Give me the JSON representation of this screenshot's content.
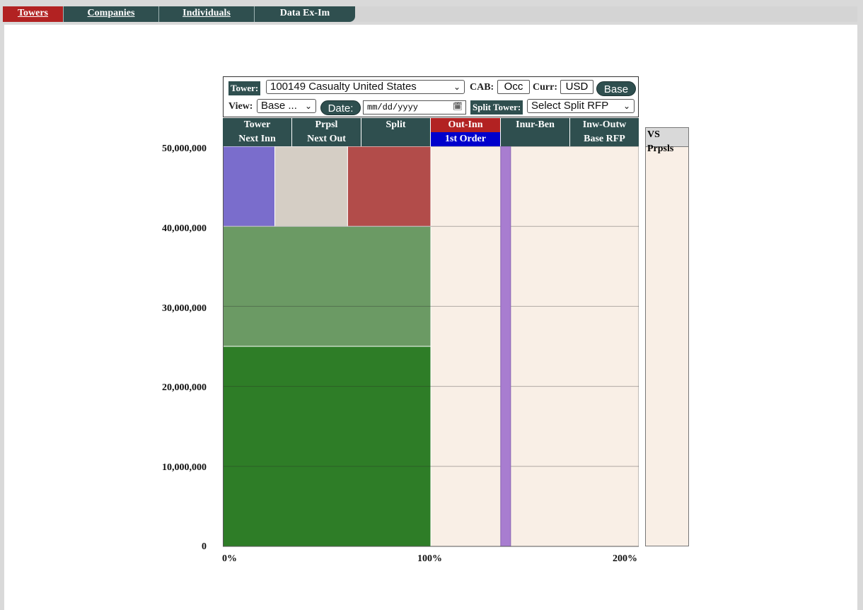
{
  "nav": {
    "tabs": [
      "Towers",
      "Companies",
      "Individuals",
      "Data Ex-Im"
    ]
  },
  "controls": {
    "tower_label": "Tower:",
    "tower_value": "100149 Casualty United States",
    "cab_label": "CAB:",
    "cab_value": "Occ",
    "curr_label": "Curr:",
    "curr_value": "USD",
    "base_button": "Base",
    "view_label": "View:",
    "view_value": "Base ...",
    "date_button": "Date:",
    "date_placeholder": "mm/dd/yyyy",
    "split_label": "Split Tower:",
    "split_value": "Select Split RFP"
  },
  "header_row1": [
    "Tower",
    "Prpsl",
    "Split",
    "Out-Inn",
    "Inur-Ben",
    "Inw-Outw"
  ],
  "header_row2": [
    "Next Inn",
    "Next Out",
    "",
    "1st Order",
    "",
    "Base RFP"
  ],
  "vs_label": "VS Prpsls",
  "chart_data": {
    "type": "bar",
    "y_ticks": [
      "50,000,000",
      "40,000,000",
      "30,000,000",
      "20,000,000",
      "10,000,000",
      "0"
    ],
    "x_ticks": [
      "0%",
      "100%",
      "200%"
    ],
    "ylim": [
      0,
      50000000
    ],
    "xlim": [
      0,
      200
    ],
    "layers": [
      {
        "y0": 0,
        "y1": 25000000,
        "x0": 0,
        "x1": 100,
        "color": "#2e7d27"
      },
      {
        "y0": 25000000,
        "y1": 40000000,
        "x0": 0,
        "x1": 100,
        "color": "#6b9a64"
      },
      {
        "y0": 40000000,
        "y1": 50000000,
        "x0": 0,
        "x1": 25,
        "color": "#7a6dcc"
      },
      {
        "y0": 40000000,
        "y1": 50000000,
        "x0": 25,
        "x1": 60,
        "color": "#d5cec5"
      },
      {
        "y0": 40000000,
        "y1": 50000000,
        "x0": 60,
        "x1": 100,
        "color": "#b24c4a"
      }
    ],
    "remainder_color": "#f9efe6",
    "marker": {
      "x": 136,
      "color": "#a87dd0"
    }
  }
}
